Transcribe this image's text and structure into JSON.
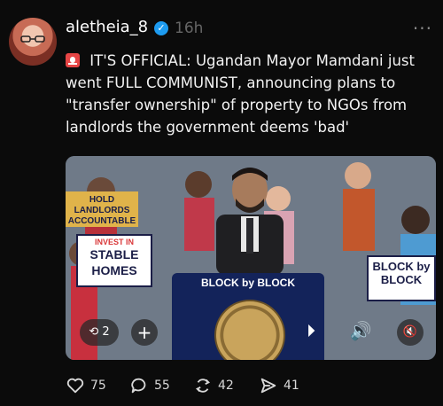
{
  "post": {
    "username": "aletheia_8",
    "time": "16h",
    "more": "···",
    "text": "IT'S OFFICIAL: Ugandan Mayor Mamdani just went FULL COMMUNIST, announcing plans to \"transfer ownership\" of property to NGOs from landlords the government deems 'bad'"
  },
  "media": {
    "signs": {
      "stable_top": "INVEST IN",
      "stable_main": "STABLE HOMES",
      "hold": "HOLD LANDLORDS ACCOUNTABLE",
      "block_right": "BLOCK by BLOCK",
      "podium": "BLOCK by BLOCK"
    },
    "controls": {
      "repeat_count": "2",
      "add": "+",
      "play": "⏵",
      "volume": "🔊",
      "mute": "🔇"
    }
  },
  "actions": {
    "likes": "75",
    "replies": "55",
    "reposts": "42",
    "shares": "41"
  },
  "colors": {
    "background": "#0b0b0b",
    "verified": "#1d9bf0",
    "podium": "#13235a"
  }
}
